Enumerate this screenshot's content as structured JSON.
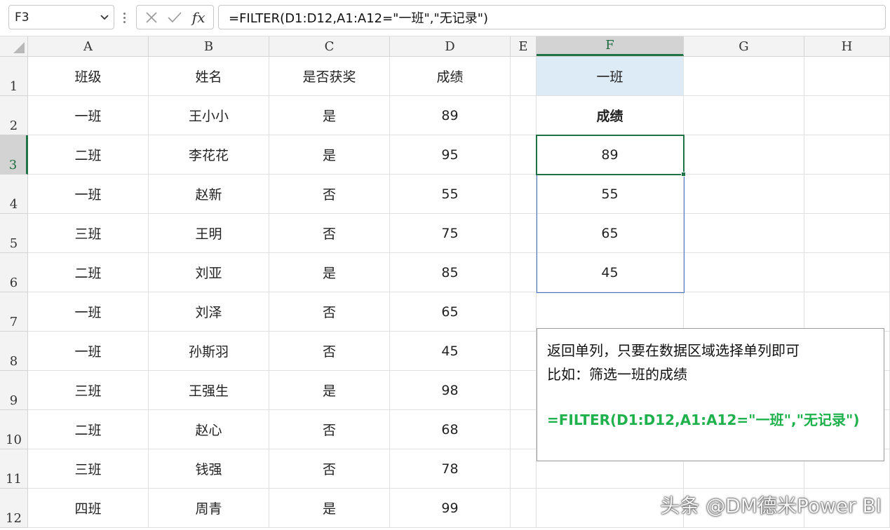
{
  "formula_bar": {
    "name_box": "F3",
    "formula": "=FILTER(D1:D12,A1:A12=\"一班\",\"无记录\")",
    "fx_label": "fx"
  },
  "columns": [
    "A",
    "B",
    "C",
    "D",
    "E",
    "F",
    "G",
    "H"
  ],
  "active_column": "F",
  "rows": [
    "1",
    "2",
    "3",
    "4",
    "5",
    "6",
    "7",
    "8",
    "9",
    "10",
    "11",
    "12"
  ],
  "active_row": "3",
  "table": [
    [
      "班级",
      "姓名",
      "是否获奖",
      "成绩"
    ],
    [
      "一班",
      "王小小",
      "是",
      "89"
    ],
    [
      "二班",
      "李花花",
      "是",
      "95"
    ],
    [
      "一班",
      "赵新",
      "否",
      "55"
    ],
    [
      "三班",
      "王明",
      "否",
      "75"
    ],
    [
      "二班",
      "刘亚",
      "是",
      "85"
    ],
    [
      "一班",
      "刘泽",
      "否",
      "65"
    ],
    [
      "一班",
      "孙斯羽",
      "否",
      "45"
    ],
    [
      "三班",
      "王强生",
      "是",
      "98"
    ],
    [
      "二班",
      "赵心",
      "否",
      "68"
    ],
    [
      "三班",
      "钱强",
      "否",
      "78"
    ],
    [
      "四班",
      "周青",
      "是",
      "99"
    ]
  ],
  "result": {
    "header": "一班",
    "subheader": "成绩",
    "values": [
      "89",
      "55",
      "65",
      "45"
    ]
  },
  "note": {
    "line1": "返回单列，只要在数据区域选择单列即可",
    "line2": "比如：筛选一班的成绩",
    "formula": "=FILTER(D1:D12,A1:A12=\"一班\",\"无记录\")"
  },
  "watermark": "头条 @DM德米Power BI",
  "colors": {
    "selection": "#217346",
    "spill": "#4472c4",
    "highlight": "#ddebf7",
    "note_formula": "#1fb14c"
  }
}
